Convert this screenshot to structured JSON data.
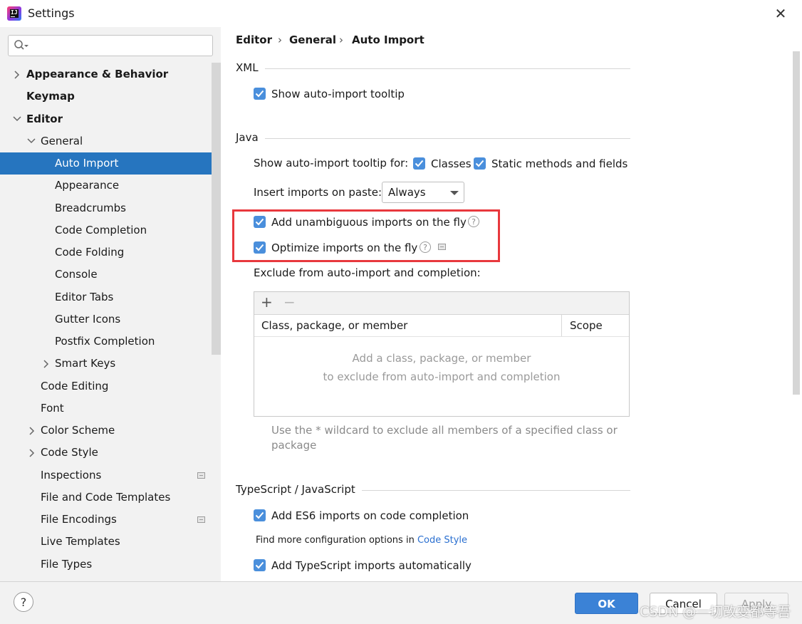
{
  "window": {
    "title": "Settings"
  },
  "search": {
    "value": ""
  },
  "tree": {
    "items": [
      {
        "label": "Appearance & Behavior"
      },
      {
        "label": "Keymap"
      },
      {
        "label": "Editor"
      },
      {
        "label": "General"
      },
      {
        "label": "Auto Import"
      },
      {
        "label": "Appearance"
      },
      {
        "label": "Breadcrumbs"
      },
      {
        "label": "Code Completion"
      },
      {
        "label": "Code Folding"
      },
      {
        "label": "Console"
      },
      {
        "label": "Editor Tabs"
      },
      {
        "label": "Gutter Icons"
      },
      {
        "label": "Postfix Completion"
      },
      {
        "label": "Smart Keys"
      },
      {
        "label": "Code Editing"
      },
      {
        "label": "Font"
      },
      {
        "label": "Color Scheme"
      },
      {
        "label": "Code Style"
      },
      {
        "label": "Inspections"
      },
      {
        "label": "File and Code Templates"
      },
      {
        "label": "File Encodings"
      },
      {
        "label": "Live Templates"
      },
      {
        "label": "File Types"
      }
    ]
  },
  "breadcrumb": {
    "part1": "Editor",
    "sep": "›",
    "part2": "General",
    "part3": "Auto Import"
  },
  "xml": {
    "title": "XML",
    "show_tooltip": {
      "label": "Show auto-import tooltip",
      "checked": true
    }
  },
  "java": {
    "title": "Java",
    "tooltip_for_label": "Show auto-import tooltip for:",
    "classes": {
      "label": "Classes",
      "checked": true
    },
    "static_methods": {
      "label": "Static methods and fields",
      "checked": true
    },
    "paste_label": "Insert imports on paste:",
    "paste_value": "Always",
    "unambiguous": {
      "label": "Add unambiguous imports on the fly",
      "checked": true
    },
    "optimize": {
      "label": "Optimize imports on the fly",
      "checked": true
    },
    "exclude_label": "Exclude from auto-import and completion:",
    "table": {
      "add": "+",
      "remove": "−",
      "col1": "Class, package, or member",
      "col2": "Scope",
      "empty_line1": "Add a class, package, or member",
      "empty_line2": "to exclude from auto-import and completion"
    },
    "hint_line1": "Use the * wildcard to exclude all members of a specified class or",
    "hint_line2": "package"
  },
  "ts": {
    "title": "TypeScript / JavaScript",
    "es6": {
      "label": "Add ES6 imports on code completion",
      "checked": true
    },
    "more_prefix": "Find more configuration options in ",
    "more_link": "Code Style",
    "ts_auto": {
      "label": "Add TypeScript imports automatically",
      "checked": true
    }
  },
  "footer": {
    "help": "?",
    "ok": "OK",
    "cancel": "Cancel",
    "apply": "Apply",
    "watermark": "CSDN @一切改变都等吾"
  },
  "colors": {
    "selection": "#2675bf",
    "checkbox": "#4a8fdc",
    "highlight_box": "#e8383d",
    "ok_button": "#3b82d6",
    "link": "#2a6fd0"
  }
}
